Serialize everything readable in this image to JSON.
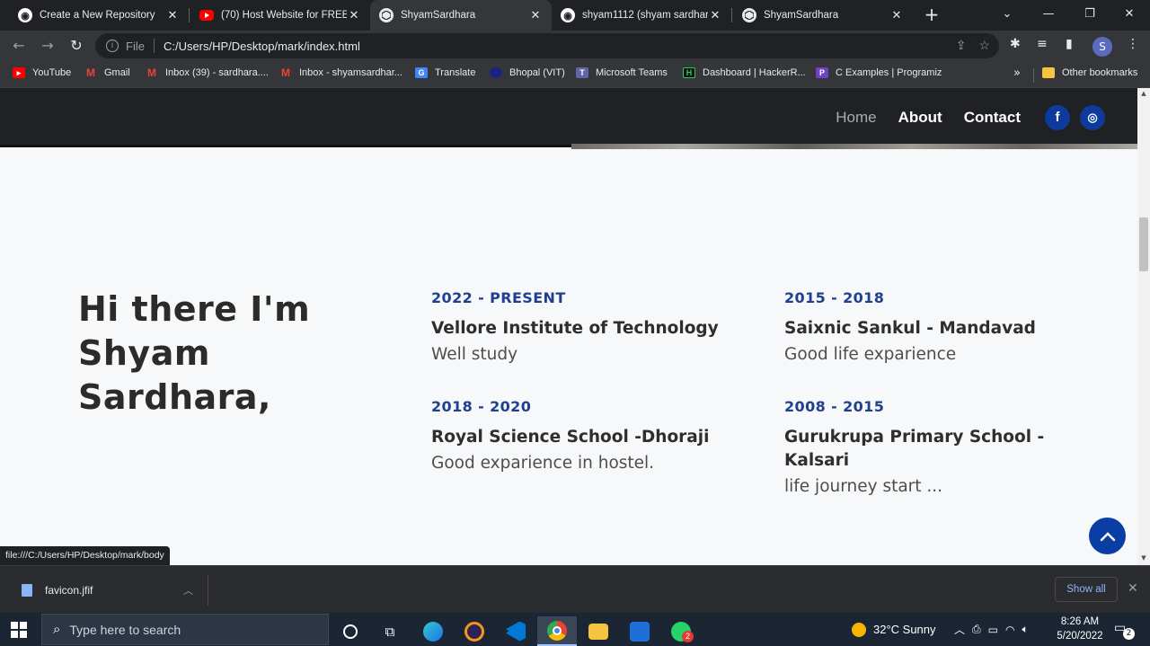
{
  "browser": {
    "tabs": [
      {
        "title": "Create a New Repository",
        "icon": "github-icon"
      },
      {
        "title": "(70) Host Website for FREE on",
        "icon": "youtube-icon"
      },
      {
        "title": "ShyamSardhara",
        "icon": "codepen-icon"
      },
      {
        "title": "shyam1112 (shyam sardhara)",
        "icon": "github-icon"
      },
      {
        "title": "ShyamSardhara",
        "icon": "codepen-icon"
      }
    ],
    "active_tab_index": 2,
    "omnibox": {
      "scheme_label": "File",
      "url": "C:/Users/HP/Desktop/mark/index.html"
    },
    "profile_initial": "S",
    "bookmarks": [
      {
        "label": "YouTube",
        "color": "#ff0000"
      },
      {
        "label": "Gmail",
        "color": "#ea4335"
      },
      {
        "label": "Inbox (39) - sardhara....",
        "color": "#ea4335"
      },
      {
        "label": "Inbox - shyamsardhar...",
        "color": "#ea4335"
      },
      {
        "label": "Translate",
        "color": "#4285f4"
      },
      {
        "label": "Bhopal (VIT)",
        "color": "#1a237e"
      },
      {
        "label": "Microsoft Teams",
        "color": "#6264a7"
      },
      {
        "label": "Dashboard | HackerR...",
        "color": "#111111"
      },
      {
        "label": "C Examples | Programiz",
        "color": "#6f42c1"
      }
    ],
    "other_bookmarks": "Other bookmarks",
    "status_url": "file:///C:/Users/HP/Desktop/mark/body"
  },
  "site": {
    "nav": [
      {
        "label": "Home",
        "current": true
      },
      {
        "label": "About",
        "current": false
      },
      {
        "label": "Contact",
        "current": false
      }
    ],
    "social": {
      "facebook": "f",
      "instagram": "◎"
    },
    "greeting": "Hi there I'm Shyam Sardhara,",
    "education": [
      {
        "years": "2022 - PRESENT",
        "school": "Vellore Institute of Technology",
        "note": "Well study"
      },
      {
        "years": "2015 - 2018",
        "school": "Saixnic Sankul - Mandavad",
        "note": "Good life exparience"
      },
      {
        "years": "2018 - 2020",
        "school": "Royal Science School -Dhoraji",
        "note": "Good exparience in hostel."
      },
      {
        "years": "2008 - 2015",
        "school": "Gurukrupa Primary School - Kalsari",
        "note": "life journey start ..."
      }
    ],
    "accent_color": "#0b3ea5"
  },
  "downloads": {
    "file_name": "favicon.jfif",
    "show_all": "Show all"
  },
  "taskbar": {
    "search_placeholder": "Type here to search",
    "weather": "32°C  Sunny",
    "time": "8:26 AM",
    "date": "5/20/2022",
    "notification_count": "2",
    "whatsapp_badge": "2"
  }
}
